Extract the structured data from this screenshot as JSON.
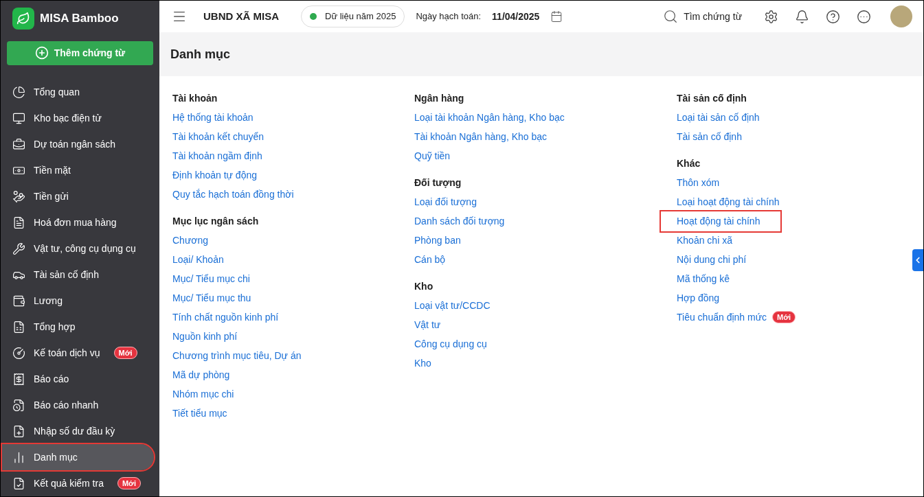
{
  "sidebar": {
    "logo": "MISA Bamboo",
    "add_button": "Thêm chứng từ",
    "items": [
      {
        "label": "Tổng quan",
        "selected": false,
        "highlighted": false
      },
      {
        "label": "Kho bạc điện tử",
        "selected": false,
        "highlighted": false
      },
      {
        "label": "Dự toán ngân sách",
        "selected": false,
        "highlighted": false
      },
      {
        "label": "Tiền mặt",
        "selected": false,
        "highlighted": false
      },
      {
        "label": "Tiền gửi",
        "selected": false,
        "highlighted": false
      },
      {
        "label": "Hoá đơn mua hàng",
        "selected": false,
        "highlighted": false
      },
      {
        "label": "Vật tư, công cụ dụng cụ",
        "selected": false,
        "highlighted": false
      },
      {
        "label": "Tài sản cố định",
        "selected": false,
        "highlighted": false
      },
      {
        "label": "Lương",
        "selected": false,
        "highlighted": false
      },
      {
        "label": "Tổng hợp",
        "selected": false,
        "highlighted": false
      },
      {
        "label": "Kế toán dịch vụ",
        "badge": "Mới",
        "selected": false,
        "highlighted": false
      },
      {
        "label": "Báo cáo",
        "selected": false,
        "highlighted": false
      },
      {
        "label": "Báo cáo nhanh",
        "selected": false,
        "highlighted": false
      },
      {
        "label": "Nhập số dư đầu kỳ",
        "selected": false,
        "highlighted": false
      },
      {
        "label": "Danh mục",
        "selected": true,
        "highlighted": true
      },
      {
        "label": "Kết quả kiểm tra",
        "badge": "Mới",
        "selected": false,
        "highlighted": false
      }
    ]
  },
  "topbar": {
    "organization": "UBND XÃ MISA",
    "data_year": "Dữ liệu năm 2025",
    "date_label": "Ngày hạch toán:",
    "date": "11/04/2025",
    "search": "Tìm chứng từ"
  },
  "page_title": "Danh mục",
  "columns": [
    [
      {
        "title": "Tài khoản",
        "items": [
          {
            "label": "Hệ thống tài khoản",
            "highlighted": false
          },
          {
            "label": "Tài khoản kết chuyển",
            "highlighted": false
          },
          {
            "label": "Tài khoản ngầm định",
            "highlighted": false
          },
          {
            "label": "Định khoản tự động",
            "highlighted": false
          },
          {
            "label": "Quy tắc hạch toán đồng thời",
            "highlighted": false
          }
        ]
      },
      {
        "title": "Mục lục ngân sách",
        "items": [
          {
            "label": "Chương",
            "highlighted": false
          },
          {
            "label": "Loại/ Khoản",
            "highlighted": false
          },
          {
            "label": "Mục/ Tiểu mục chi",
            "highlighted": false
          },
          {
            "label": "Mục/ Tiểu mục thu",
            "highlighted": false
          },
          {
            "label": "Tính chất nguồn kinh phí",
            "highlighted": false
          },
          {
            "label": "Nguồn kinh phí",
            "highlighted": false
          },
          {
            "label": "Chương trình mục tiêu, Dự án",
            "highlighted": false
          },
          {
            "label": "Mã dự phòng",
            "highlighted": false
          },
          {
            "label": "Nhóm mục chi",
            "highlighted": false
          },
          {
            "label": "Tiết tiểu mục",
            "highlighted": false
          }
        ]
      }
    ],
    [
      {
        "title": "Ngân hàng",
        "items": [
          {
            "label": "Loại tài khoản Ngân hàng, Kho bạc",
            "highlighted": false
          },
          {
            "label": "Tài khoản Ngân hàng, Kho bạc",
            "highlighted": false
          },
          {
            "label": "Quỹ tiền",
            "highlighted": false
          }
        ]
      },
      {
        "title": "Đối tượng",
        "items": [
          {
            "label": "Loại đối tượng",
            "highlighted": false
          },
          {
            "label": "Danh sách đối tượng",
            "highlighted": false
          },
          {
            "label": "Phòng ban",
            "highlighted": false
          },
          {
            "label": "Cán bộ",
            "highlighted": false
          }
        ]
      },
      {
        "title": "Kho",
        "items": [
          {
            "label": "Loại vật tư/CCDC",
            "highlighted": false
          },
          {
            "label": "Vật tư",
            "highlighted": false
          },
          {
            "label": "Công cụ dụng cụ",
            "highlighted": false
          },
          {
            "label": "Kho",
            "highlighted": false
          }
        ]
      }
    ],
    [
      {
        "title": "Tài sản cố định",
        "items": [
          {
            "label": "Loại tài sản cố định",
            "highlighted": false
          },
          {
            "label": "Tài sản cố định",
            "highlighted": false
          }
        ]
      },
      {
        "title": "Khác",
        "items": [
          {
            "label": "Thôn xóm",
            "highlighted": false
          },
          {
            "label": "Loại hoạt động tài chính",
            "highlighted": false
          },
          {
            "label": "Hoạt động tài chính",
            "highlighted": true
          },
          {
            "label": "Khoản chi xã",
            "highlighted": false
          },
          {
            "label": "Nội dung chi phí",
            "highlighted": false
          },
          {
            "label": "Mã thống kê",
            "highlighted": false
          },
          {
            "label": "Hợp đồng",
            "highlighted": false
          },
          {
            "label": "Tiêu chuẩn định mức",
            "badge": "Mới",
            "highlighted": false
          }
        ]
      }
    ]
  ]
}
